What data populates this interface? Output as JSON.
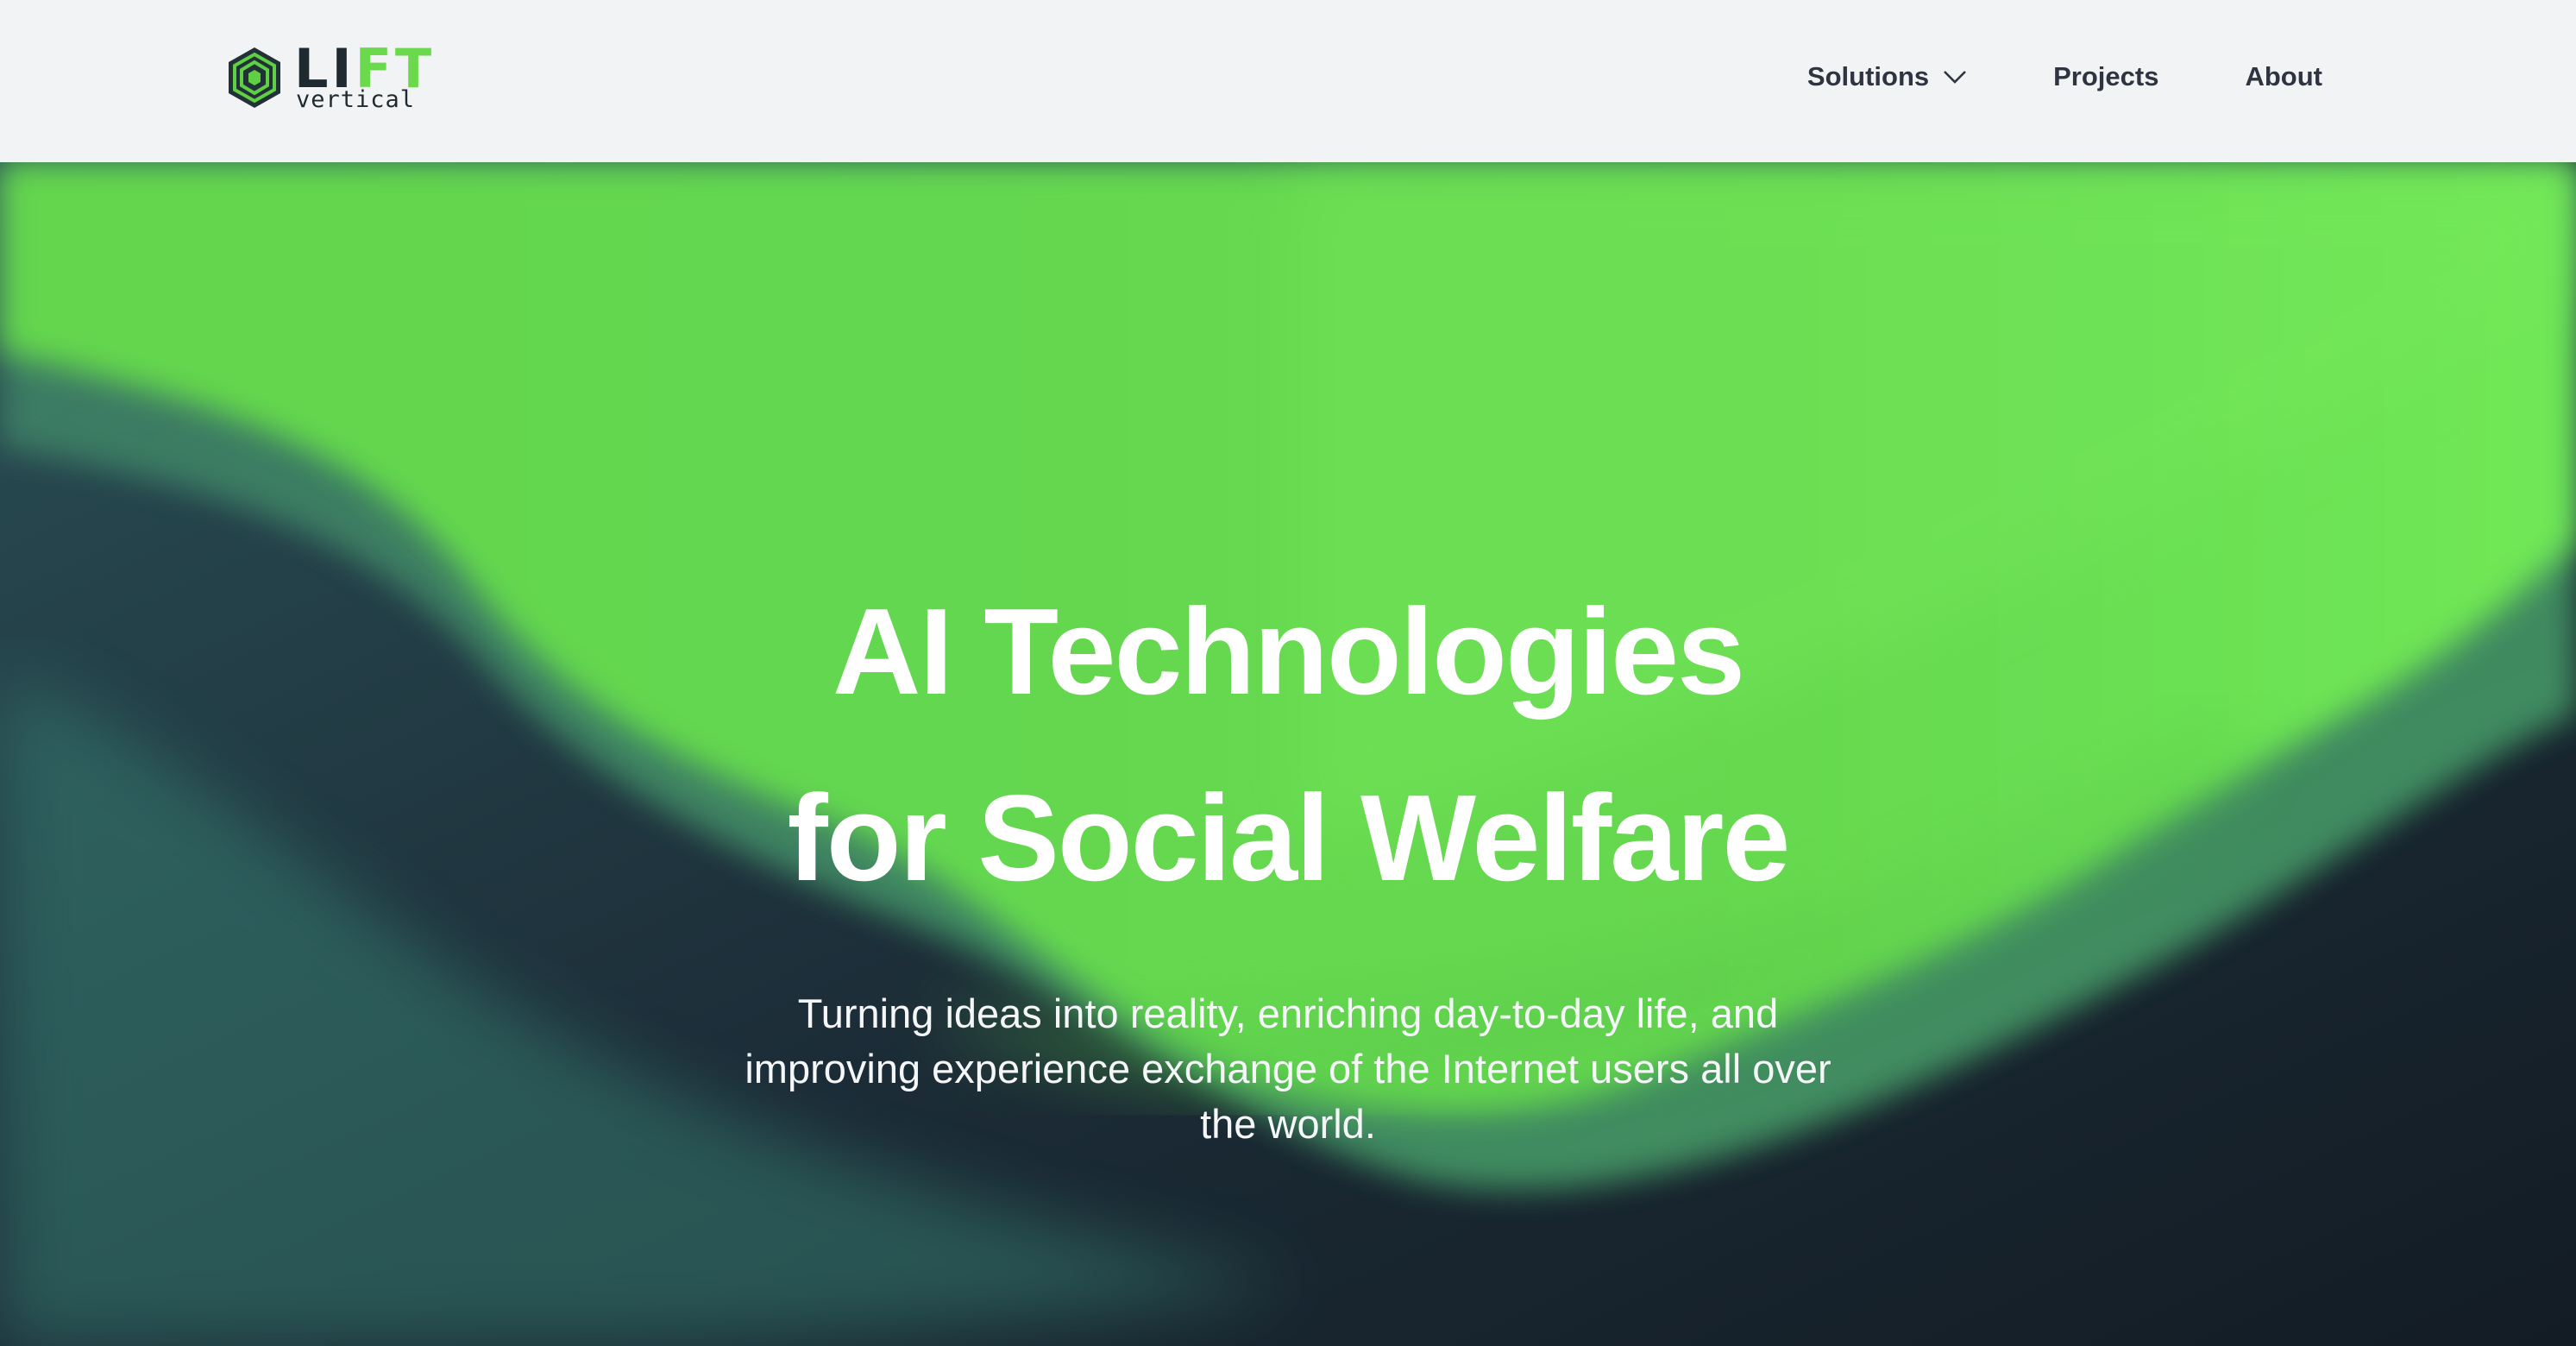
{
  "brand": {
    "logo_text_part1": "LI",
    "logo_text_part2": "FT",
    "logo_subtext": "vertical",
    "logo_icon": "hexagon-cube-icon",
    "colors": {
      "accent_green": "#6bd94c",
      "dark": "#1f2a30"
    }
  },
  "nav": {
    "items": [
      {
        "label": "Solutions",
        "has_dropdown": true,
        "icon": "chevron-down-icon"
      },
      {
        "label": "Projects"
      },
      {
        "label": "About"
      }
    ]
  },
  "hero": {
    "headline_line1": "AI Technologies",
    "headline_line2": "for Social Welfare",
    "subtitle": "Turning ideas into reality, enriching day-to-day life, and improving experience exchange of the Internet users all over the world.",
    "colors": {
      "green": "#67d850",
      "teal": "#2f5e5c",
      "dark_navy": "#1a2833"
    }
  }
}
